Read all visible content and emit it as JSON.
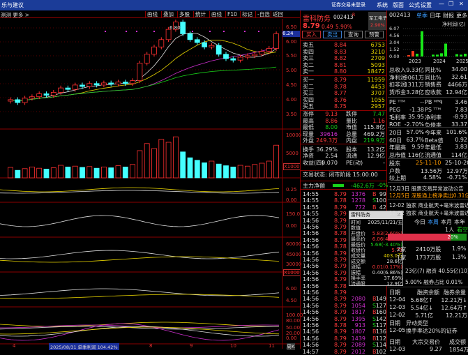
{
  "window": {
    "title": "乐与建议",
    "login_status": "证券交易未登录",
    "menu": [
      "系统",
      "版面",
      "公式",
      "设置"
    ],
    "min": "—",
    "restore": "❐",
    "close": "✕"
  },
  "toolbar": {
    "left": "测测  更多 >",
    "buttons": [
      "画线",
      "叠加",
      "多股",
      "统计",
      "画线",
      "F10",
      "标记",
      "-自选",
      "返回"
    ]
  },
  "chart": {
    "high_label": "6.80",
    "current_price_tag": "6.24",
    "price_axis": [
      "6.50",
      "6.00",
      "5.50",
      "5.00",
      "4.50",
      "4.00",
      "3.50"
    ],
    "volume_axis": [
      "10000",
      "5000",
      "X1000"
    ],
    "ind1_axis": [
      "0.25",
      "0.00"
    ],
    "ind2_axis": [
      "150.0",
      "0.00"
    ],
    "ind3_axis": [
      "60000",
      "45000",
      "30000",
      "X1000"
    ],
    "ind4_axis": [
      "6.00",
      "4.50"
    ],
    "ind5_axis": [
      "100.00",
      "80.00",
      "50.00",
      "20.00",
      "0.00"
    ],
    "date_labels": [
      "4",
      "8",
      "9",
      "10",
      "11"
    ],
    "hover_info": "2025/08/31 单季利润 104.42%",
    "period": "周K",
    "closes": [
      4.05,
      3.95,
      4.1,
      4.15,
      4.25,
      4.2,
      4.3,
      4.45,
      4.4,
      4.55,
      4.5,
      4.6,
      4.55,
      4.62,
      4.58,
      4.65,
      4.6,
      4.7,
      5.3,
      5.6,
      5.85,
      6.1,
      6.45,
      6.7,
      6.3,
      6.1,
      6.0,
      5.85,
      5.9,
      5.6,
      5.45,
      5.4,
      5.5,
      5.55,
      5.6,
      5.7,
      5.8,
      6.3
    ],
    "volumes": [
      2500,
      1800,
      2200,
      2600,
      2300,
      2100,
      2400,
      3000,
      2600,
      2800,
      2500,
      2700,
      2300,
      2600,
      2400,
      2900,
      2600,
      3200,
      6500,
      8200,
      7000,
      9200,
      8500,
      9800,
      6200,
      4800,
      4200,
      3600,
      4000,
      3300,
      2900,
      2600,
      3000,
      2800,
      3200,
      3500,
      4000,
      7800
    ]
  },
  "quote": {
    "name": "雷科防务",
    "code": "002413",
    "flag": "R",
    "sector": "军工电子",
    "sector_change": "2.90%",
    "price": "8.79",
    "change": "0.49",
    "change_pct": "5.90%",
    "buttons": [
      "买入",
      "卖出",
      "查询",
      "预警"
    ],
    "asks": [
      {
        "label": "卖五",
        "price": "8.84",
        "vol": "6753"
      },
      {
        "label": "卖四",
        "price": "8.83",
        "vol": "3210"
      },
      {
        "label": "卖三",
        "price": "8.82",
        "vol": "2709"
      },
      {
        "label": "卖二",
        "price": "8.81",
        "vol": "5093"
      },
      {
        "label": "卖一",
        "price": "8.80",
        "vol": "18472"
      }
    ],
    "bids": [
      {
        "label": "买一",
        "price": "8.79",
        "vol": "11959"
      },
      {
        "label": "买二",
        "price": "8.78",
        "vol": "4453"
      },
      {
        "label": "买三",
        "price": "8.77",
        "vol": "3707"
      },
      {
        "label": "买四",
        "price": "8.76",
        "vol": "1055"
      },
      {
        "label": "买五",
        "price": "8.75",
        "vol": "2957"
      }
    ],
    "stats": [
      {
        "l1": "涨停",
        "v1": "9.13",
        "c1": "r",
        "l2": "跌停",
        "v2": "7.47",
        "c2": "g"
      },
      {
        "l1": "最高",
        "v1": "8.86",
        "c1": "r",
        "l2": "量比",
        "v2": "1.16",
        "c2": "r"
      },
      {
        "l1": "最低",
        "v1": "8.00",
        "c1": "g",
        "l2": "市值",
        "v2": "115.8亿",
        "c2": "w"
      },
      {
        "l1": "现量",
        "v1": "39616",
        "c1": "m",
        "l2": "总量",
        "v2": "469.2万",
        "c2": "w"
      },
      {
        "l1": "外盘",
        "v1": "249.3万",
        "c1": "r",
        "l2": "内盘",
        "v2": "219.9万",
        "c2": "g"
      },
      {
        "l1": "换手",
        "v1": "36.29%",
        "c1": "w",
        "l2": "股本",
        "v2": "13.2亿",
        "c2": "w"
      },
      {
        "l1": "净资",
        "v1": "2.54",
        "c1": "w",
        "l2": "流通",
        "v2": "12.9亿",
        "c2": "w"
      },
      {
        "l1": "收益(四)",
        "v1": "-0.070",
        "c1": "w",
        "l2": "PE(动)",
        "v2": "-",
        "c2": "w"
      }
    ],
    "status": "交易状态: 闭市阶段 15:00:00",
    "main_force_label": "主力净额",
    "main_force_value": "-462.6万",
    "main_force_pct": "-0%",
    "trades": [
      {
        "t": "14:55",
        "p": "8.79",
        "v": "1376",
        "d": "B",
        "n": "99"
      },
      {
        "t": "14:55",
        "p": "8.78",
        "v": "1278",
        "d": "S",
        "n": "100"
      },
      {
        "t": "14:55",
        "p": "8.79",
        "v": "772",
        "d": "B",
        "n": "42"
      },
      {
        "t": "14:55",
        "p": "8.79",
        "v": "943",
        "d": "B",
        "n": "79"
      },
      {
        "t": "14:56",
        "p": "8.79"
      },
      {
        "t": "14:56",
        "p": "8.79"
      },
      {
        "t": "14:56",
        "p": "8.78"
      },
      {
        "t": "14:56",
        "p": "8.79"
      },
      {
        "t": "14:56",
        "p": "8.78"
      },
      {
        "t": "14:56",
        "p": "8.79"
      },
      {
        "t": "14:56",
        "p": "8.79"
      },
      {
        "t": "14:56",
        "p": "8.79"
      },
      {
        "t": "14:56",
        "p": "8.79"
      },
      {
        "t": "14:56",
        "p": "8.79"
      },
      {
        "t": "14:56",
        "p": "8.78"
      },
      {
        "t": "14:56",
        "p": "8.79"
      },
      {
        "t": "14:56",
        "p": "8.79",
        "v": "2080",
        "d": "B",
        "n": "149"
      },
      {
        "t": "14:56",
        "p": "8.79",
        "v": "1054",
        "d": "S",
        "n": "127"
      },
      {
        "t": "14:56",
        "p": "8.79",
        "v": "1817",
        "d": "B",
        "n": "160"
      },
      {
        "t": "14:56",
        "p": "8.79",
        "v": "1395",
        "d": "S",
        "n": "142"
      },
      {
        "t": "14:56",
        "p": "8.78",
        "v": "913",
        "d": "S",
        "n": "117"
      },
      {
        "t": "14:56",
        "p": "8.79",
        "v": "1807",
        "d": "B",
        "n": "136"
      },
      {
        "t": "14:56",
        "p": "8.79",
        "v": "1439",
        "d": "B",
        "n": "112"
      },
      {
        "t": "14:56",
        "p": "8.79",
        "v": "2089",
        "d": "S",
        "n": "114"
      },
      {
        "t": "14:57",
        "p": "8.79",
        "v": "2012",
        "d": "B",
        "n": "102"
      }
    ]
  },
  "tooltip": {
    "title": "雷科防务",
    "close": "✕",
    "rows": [
      {
        "k": "时间",
        "v": "2025/11/21/五",
        "c": "w"
      },
      {
        "k": "数值",
        "v": "",
        "c": "w"
      },
      {
        "k": "开盘价",
        "v": "5.83(2.60%)",
        "c": "r"
      },
      {
        "k": "最高价",
        "v": "6.06(4.02%)",
        "c": "r"
      },
      {
        "k": "最低价",
        "v": "5.68(-3.40%)",
        "c": "g"
      },
      {
        "k": "收盘价",
        "v": "5.79",
        "c": "r"
      },
      {
        "k": "成交量",
        "v": "403.0万",
        "c": "y"
      },
      {
        "k": "成交额",
        "v": "28.6亿",
        "c": "w"
      },
      {
        "k": "涨幅",
        "v": "0.01(0.17%)",
        "c": "r"
      },
      {
        "k": "振幅",
        "v": "0.40(6.86%)",
        "c": "w"
      },
      {
        "k": "换手率",
        "v": "37.69%",
        "c": "w"
      },
      {
        "k": "流通股",
        "v": "12.9亿",
        "c": "w"
      }
    ]
  },
  "right": {
    "code": "002413",
    "tabs": [
      "单季",
      "日年",
      "财报",
      "更多.."
    ],
    "chart_title": "净利润(亿)",
    "y_axis": [
      "6.07",
      "4.56",
      "3.04",
      "1.52",
      "0.00"
    ],
    "years": [
      "2023",
      "2024",
      "2025"
    ],
    "profit_bars": [
      [
        0.3,
        1.2,
        0.6,
        5.5
      ],
      [
        0.4,
        0.4,
        0.7,
        2.8
      ],
      [
        0.5,
        0.4,
        0.6
      ]
    ],
    "fin": [
      {
        "a": "总收入",
        "b": "9.33亿",
        "c": "同比%",
        "d": "34.00"
      },
      {
        "a": "净利润",
        "b": "9061万",
        "c": "同比%",
        "d": "32.61"
      },
      {
        "a": "扣非润",
        "b": "1311万",
        "c": "销售费",
        "d": "4466万"
      },
      {
        "a": "货币金",
        "b": "3.28亿",
        "c": "应收款",
        "d": "12.94亿"
      }
    ],
    "val": [
      {
        "a": "PE ᵀᵀᴹ",
        "b": "--",
        "c": "PB ᴹᴿᑫ",
        "d": "3.46"
      },
      {
        "a": "PEG",
        "b": "-1.38",
        "c": "PS ᵀᵀᴹ",
        "d": "7.83"
      },
      {
        "a": "毛利率",
        "b": "35.95",
        "c": "净利率",
        "d": "-8.93"
      },
      {
        "a": "ROE",
        "b": "-2.70%",
        "c": "负债率",
        "d": "33.37"
      }
    ],
    "perf": [
      {
        "a": "20日",
        "b": "57.0%",
        "c": "今年来",
        "d": "101.6%"
      },
      {
        "a": "60日",
        "b": "63.7%",
        "c": "Beta值",
        "d": "0.92"
      },
      {
        "a": "年最高",
        "b": "9.59",
        "c": "年最低",
        "d": "3.83"
      },
      {
        "a": "总市值",
        "b": "116亿",
        "c": "流通值",
        "d": "114亿"
      }
    ],
    "holders": {
      "label": "股东",
      "d1": "25-11-10",
      "d2": "25-10-20",
      "r1": "户数",
      "r1a": "13.56万",
      "r1b": "12.97万",
      "r2": "较上期",
      "r2a": "4.58%",
      "r2b": "-0.71%"
    },
    "events": [
      "12月3日 股票交易异常波动公告",
      "12月5日 深股通上榜净卖出0.31亿..."
    ],
    "news": [
      "12-02 独家 商业航天+毫米波雷达...",
      "12-02 独家 商业航天+毫米波雷达..."
    ],
    "periods": [
      "今日",
      "本周",
      "本月",
      "本年"
    ],
    "sentiment_count": "1人",
    "sentiment_label": "看空",
    "sentiment_pct": "20%",
    "sentiment_value": 0.2,
    "inst": [
      {
        "a": "2家",
        "b": "2410万股",
        "c": "1.9%"
      },
      {
        "a": "1家",
        "b": "1737万股",
        "c": "1.3%"
      }
    ],
    "margin1": "23亿(7) 融资 40.55亿(10)",
    "margin2": "5.00% 融券占比 0.01%",
    "margin_header": [
      "日期",
      "融资余额",
      "融券余量"
    ],
    "margin_rows": [
      [
        "12-04",
        "5.68亿↑",
        "12.21万↓"
      ],
      [
        "12-03",
        "5.54亿↓",
        "12.64万↑"
      ],
      [
        "12-02",
        "5.71亿",
        "12.21万"
      ]
    ],
    "abn_header": [
      "日期",
      "异动类型"
    ],
    "abn_row": [
      "12-05",
      "换手率达20%的证券"
    ],
    "block_header": [
      "日期",
      "大宗交易价",
      "成交额"
    ],
    "block_row": [
      "12-03",
      "9.27",
      "1854万"
    ]
  }
}
